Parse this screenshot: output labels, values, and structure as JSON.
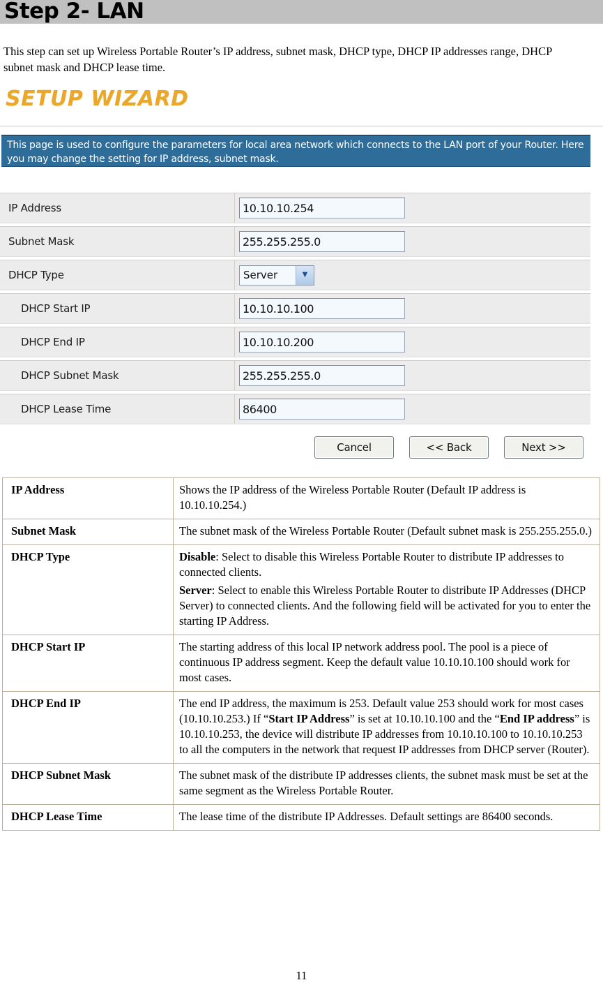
{
  "document": {
    "heading": "Step 2- LAN",
    "intro": "This step can set up Wireless Portable Router’s IP address, subnet mask, DHCP type, DHCP IP addresses range, DHCP subnet mask and DHCP lease time.",
    "page_number": "11"
  },
  "router_panel": {
    "logo": "SETUP WIZARD",
    "info_bar": "This page is used to configure the parameters for local area network which connects to the LAN port of your Router. Here you may change the setting for IP address, subnet mask.",
    "fields": [
      {
        "label": "IP Address",
        "value": "10.10.10.254",
        "type": "text",
        "indent": false
      },
      {
        "label": "Subnet Mask",
        "value": "255.255.255.0",
        "type": "text",
        "indent": false
      },
      {
        "label": "DHCP Type",
        "value": "Server",
        "type": "select",
        "indent": false
      },
      {
        "label": "DHCP Start IP",
        "value": "10.10.10.100",
        "type": "text",
        "indent": true
      },
      {
        "label": "DHCP End IP",
        "value": "10.10.10.200",
        "type": "text",
        "indent": true
      },
      {
        "label": "DHCP Subnet Mask",
        "value": "255.255.255.0",
        "type": "text",
        "indent": true
      },
      {
        "label": "DHCP Lease Time",
        "value": "86400",
        "type": "text",
        "indent": true
      }
    ],
    "buttons": [
      {
        "name": "cancel",
        "label": "Cancel"
      },
      {
        "name": "back",
        "label": "<< Back"
      },
      {
        "name": "next",
        "label": "Next >>"
      }
    ],
    "icons": {
      "dropdown": "chevron-down-icon"
    },
    "colors": {
      "heading_band": "#c0c0c0",
      "logo": "#eaa729",
      "info_bar": "#2e6c99",
      "row_background": "#ececec",
      "input_background": "#f4f9fd"
    }
  },
  "description_table": {
    "rows": [
      {
        "term": "IP Address",
        "paragraphs": [
          [
            {
              "t": "Shows the IP address of the Wireless Portable Router (Default IP address is 10.10.10.254.)",
              "b": false
            }
          ]
        ]
      },
      {
        "term": "Subnet Mask",
        "paragraphs": [
          [
            {
              "t": "The subnet mask of the Wireless Portable Router (Default subnet mask is 255.255.255.0.)",
              "b": false
            }
          ]
        ]
      },
      {
        "term": "DHCP Type",
        "paragraphs": [
          [
            {
              "t": "Disable",
              "b": true
            },
            {
              "t": ": Select to disable this Wireless Portable Router to distribute IP addresses to connected clients.",
              "b": false
            }
          ],
          [
            {
              "t": "Server",
              "b": true
            },
            {
              "t": ": Select to enable this Wireless Portable Router to distribute IP Addresses (DHCP Server) to connected clients. And the following field will be activated for you to enter the starting IP Address.",
              "b": false
            }
          ]
        ]
      },
      {
        "term": "DHCP Start IP",
        "paragraphs": [
          [
            {
              "t": "The starting address of this local IP network address pool. The pool is a piece of continuous IP address segment. Keep the default value 10.10.10.100 should work for most cases.",
              "b": false
            }
          ]
        ]
      },
      {
        "term": "DHCP End IP",
        "paragraphs": [
          [
            {
              "t": "The end IP address, the maximum is 253. Default value 253 should work for most cases (10.10.10.253.) If “",
              "b": false
            },
            {
              "t": "Start IP Address",
              "b": true
            },
            {
              "t": "” is set at 10.10.10.100 and the “",
              "b": false
            },
            {
              "t": "End IP address",
              "b": true
            },
            {
              "t": "” is 10.10.10.253, the device will distribute IP addresses from 10.10.10.100 to 10.10.10.253 to all the computers in the network that request IP addresses from DHCP server (Router).",
              "b": false
            }
          ]
        ]
      },
      {
        "term": "DHCP Subnet Mask",
        "paragraphs": [
          [
            {
              "t": "The subnet mask of the distribute IP addresses clients, the subnet mask must be set at the same segment as the Wireless Portable Router.",
              "b": false
            }
          ]
        ]
      },
      {
        "term": "DHCP Lease Time",
        "paragraphs": [
          [
            {
              "t": "The lease time of the distribute IP Addresses. Default settings are 86400 seconds.",
              "b": false
            }
          ]
        ]
      }
    ]
  }
}
